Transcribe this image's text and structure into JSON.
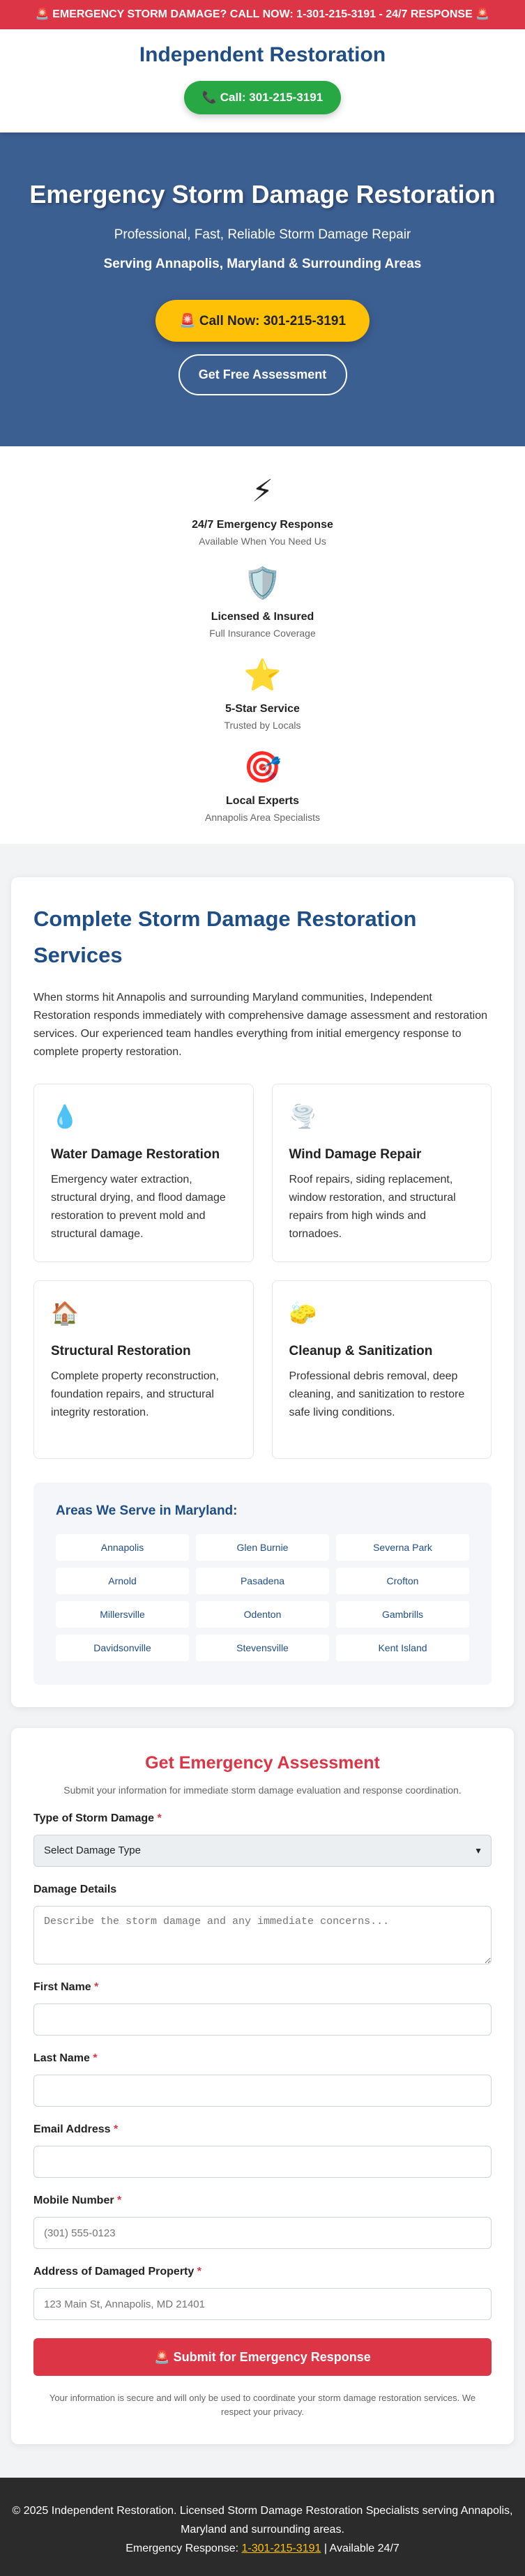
{
  "topbar": {
    "text": "🚨 EMERGENCY STORM DAMAGE? CALL NOW: 1-301-215-3191 - 24/7 RESPONSE 🚨"
  },
  "header": {
    "brand": "Independent Restoration",
    "call_label": "📞 Call: 301-215-3191"
  },
  "hero": {
    "title": "Emergency Storm Damage Restoration",
    "subtitle": "Professional, Fast, Reliable Storm Damage Repair",
    "area": "Serving Annapolis, Maryland & Surrounding Areas",
    "call_label": "🚨 Call Now: 301-215-3191",
    "assessment_label": "Get Free Assessment"
  },
  "features": [
    {
      "icon": "⚡",
      "icon_name": "lightning-icon",
      "title": "24/7 Emergency Response",
      "desc": "Available When You Need Us"
    },
    {
      "icon": "🛡️",
      "icon_name": "shield-icon",
      "title": "Licensed & Insured",
      "desc": "Full Insurance Coverage"
    },
    {
      "icon": "⭐",
      "icon_name": "star-icon",
      "title": "5-Star Service",
      "desc": "Trusted by Locals"
    },
    {
      "icon": "🎯",
      "icon_name": "target-icon",
      "title": "Local Experts",
      "desc": "Annapolis Area Specialists"
    }
  ],
  "services": {
    "title": "Complete Storm Damage Restoration Services",
    "intro": "When storms hit Annapolis and surrounding Maryland communities, Independent Restoration responds immediately with comprehensive damage assessment and restoration services. Our experienced team handles everything from initial emergency response to complete property restoration.",
    "cards": [
      {
        "icon": "💧",
        "icon_name": "water-drop-icon",
        "title": "Water Damage Restoration",
        "desc": "Emergency water extraction, structural drying, and flood damage restoration to prevent mold and structural damage."
      },
      {
        "icon": "🌪️",
        "icon_name": "tornado-icon",
        "title": "Wind Damage Repair",
        "desc": "Roof repairs, siding replacement, window restoration, and structural repairs from high winds and tornadoes."
      },
      {
        "icon": "🏠",
        "icon_name": "house-icon",
        "title": "Structural Restoration",
        "desc": "Complete property reconstruction, foundation repairs, and structural integrity restoration."
      },
      {
        "icon": "🧽",
        "icon_name": "sponge-icon",
        "title": "Cleanup & Sanitization",
        "desc": "Professional debris removal, deep cleaning, and sanitization to restore safe living conditions."
      }
    ],
    "areas_title": "Areas We Serve in Maryland:",
    "areas": [
      "Annapolis",
      "Glen Burnie",
      "Severna Park",
      "Arnold",
      "Pasadena",
      "Crofton",
      "Millersville",
      "Odenton",
      "Gambrills",
      "Davidsonville",
      "Stevensville",
      "Kent Island"
    ]
  },
  "form": {
    "title": "Get Emergency Assessment",
    "subtitle": "Submit your information for immediate storm damage evaluation and response coordination.",
    "damage_type": {
      "label": "Type of Storm Damage",
      "required_mark": "*",
      "value": "Select Damage Type"
    },
    "details": {
      "label": "Damage Details",
      "placeholder": "Describe the storm damage and any immediate concerns..."
    },
    "first_name": {
      "label": "First Name",
      "required_mark": "*",
      "placeholder": ""
    },
    "last_name": {
      "label": "Last Name",
      "required_mark": "*",
      "placeholder": ""
    },
    "email": {
      "label": "Email Address",
      "required_mark": "*",
      "placeholder": ""
    },
    "mobile": {
      "label": "Mobile Number",
      "required_mark": "*",
      "placeholder": "(301) 555-0123"
    },
    "address": {
      "label": "Address of Damaged Property",
      "required_mark": "*",
      "placeholder": "123 Main St, Annapolis, MD 21401"
    },
    "submit_label": "🚨 Submit for Emergency Response",
    "privacy": "Your information is secure and will only be used to coordinate your storm damage restoration services. We respect your privacy."
  },
  "footer": {
    "copyright": "© 2025 Independent Restoration. Licensed Storm Damage Restoration Specialists serving Annapolis, Maryland and surrounding areas.",
    "emergency_prefix": "Emergency Response: ",
    "phone": "1-301-215-3191",
    "suffix": " | Available 24/7"
  },
  "colors": {
    "red": "#dc3545",
    "green": "#28a745",
    "hero_blue": "#3c5f92",
    "brand_blue": "#1f4e86",
    "yellow": "#ffc107",
    "footer_dark": "#2b2b2b"
  }
}
